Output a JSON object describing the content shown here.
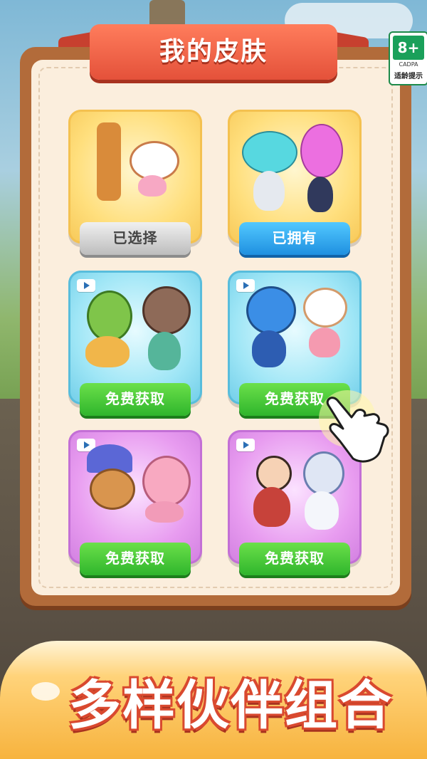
{
  "title": "我的皮肤",
  "age_rating": {
    "value": "8+",
    "org": "CADPA",
    "note": "适龄提示"
  },
  "skins": [
    {
      "button": "已选择",
      "state": "selected",
      "theme": "yellow",
      "video": false
    },
    {
      "button": "已拥有",
      "state": "owned",
      "theme": "yellow",
      "video": false
    },
    {
      "button": "免费获取",
      "state": "free",
      "theme": "blue",
      "video": true
    },
    {
      "button": "免费获取",
      "state": "free",
      "theme": "blue",
      "video": true
    },
    {
      "button": "免费获取",
      "state": "free",
      "theme": "pink",
      "video": true
    },
    {
      "button": "免费获取",
      "state": "free",
      "theme": "pink",
      "video": true
    }
  ],
  "slogan": "多样伙伴组合",
  "colors": {
    "ribbon": "#e4513a",
    "green_button": "#2fb52c",
    "blue_button": "#1f90e0",
    "panel": "#b26b3a"
  },
  "icons": [
    "video-ad-icon",
    "pointing-hand-icon"
  ]
}
